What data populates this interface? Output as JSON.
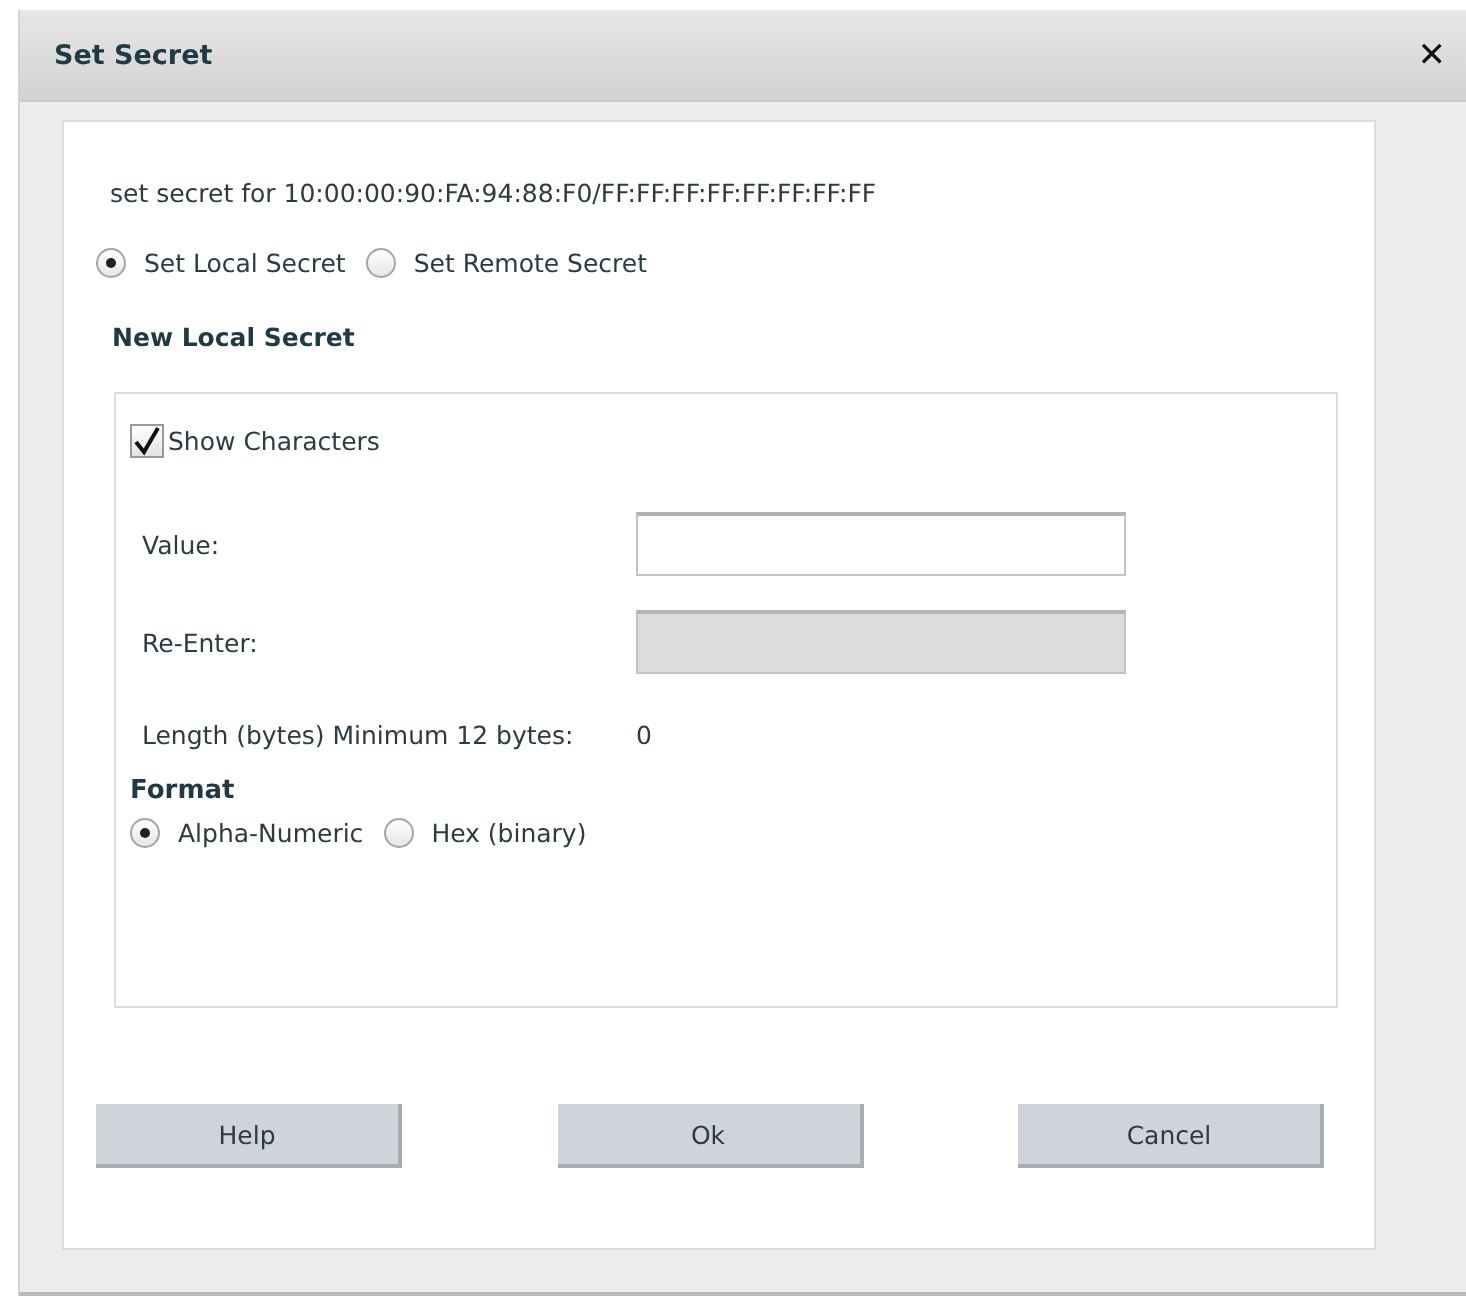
{
  "dialog": {
    "title": "Set Secret",
    "close_label": "✕"
  },
  "description": "set secret for 10:00:00:90:FA:94:88:F0/FF:FF:FF:FF:FF:FF:FF:FF",
  "secret_type": [
    {
      "label": "Set Local Secret",
      "selected": true
    },
    {
      "label": "Set Remote Secret",
      "selected": false
    }
  ],
  "section_title": "New Local Secret",
  "show_characters": {
    "label": "Show Characters",
    "checked": true
  },
  "fields": [
    {
      "label": "Value:",
      "disabled": false
    },
    {
      "label": "Re-Enter:",
      "disabled": true
    }
  ],
  "length": {
    "label": "Length (bytes) Minimum 12 bytes:",
    "value": "0"
  },
  "format": {
    "title": "Format",
    "options": [
      {
        "label": "Alpha-Numeric",
        "selected": true
      },
      {
        "label": "Hex (binary)",
        "selected": false
      }
    ]
  },
  "buttons": [
    "Help",
    "Ok",
    "Cancel"
  ]
}
